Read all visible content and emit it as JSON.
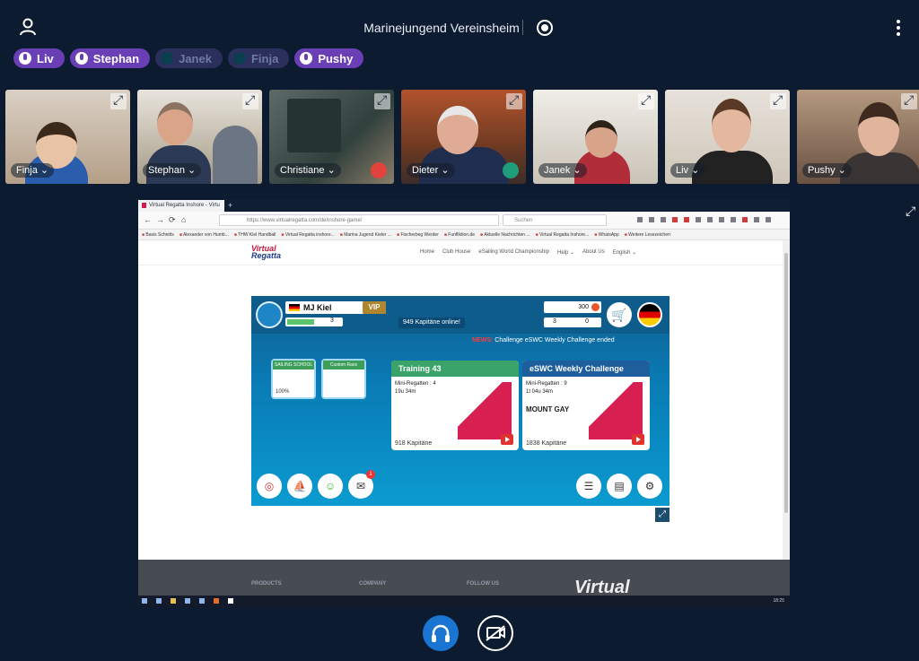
{
  "room": {
    "title": "Marinejungend Vereinsheim"
  },
  "participants_chips": [
    {
      "label": "Liv",
      "state": "active"
    },
    {
      "label": "Stephan",
      "state": "active"
    },
    {
      "label": "Janek",
      "state": "muted"
    },
    {
      "label": "Finja",
      "state": "muted"
    },
    {
      "label": "Pushy",
      "state": "active"
    }
  ],
  "tiles": [
    {
      "name": "Finja"
    },
    {
      "name": "Stephan"
    },
    {
      "name": "Christiane"
    },
    {
      "name": "Dieter"
    },
    {
      "name": "Janek"
    },
    {
      "name": "Liv"
    },
    {
      "name": "Pushy"
    }
  ],
  "browser": {
    "tab_title": "Virtual Regatta Inshore - Virtu",
    "url": "https://www.virtualregatta.com/de/inshore-game/",
    "search_placeholder": "Suchen",
    "bookmarks": [
      "Basis Schnitts",
      "Alexander von Humb...",
      "THW Kiel Handball",
      "Virtual Regatta inshore...",
      "Marina Jugend Kieler ...",
      "Fischerbeg Werder",
      "Funfliktion.de",
      "Aktuelle Nachrichten ...",
      "Virtual Regatta Inshore...",
      "WhatsApp",
      "Weitere Lesezeichen"
    ]
  },
  "site": {
    "logo_line1": "Virtual",
    "logo_line2": "Regatta",
    "nav": [
      "Home",
      "Club House",
      "eSailing World Championship",
      "Help ⌄",
      "About Us",
      "English ⌄"
    ],
    "footer": {
      "products": "PRODUCTS",
      "company": "COMPANY",
      "follow": "FOLLOW US",
      "logo": "Virtual"
    }
  },
  "game": {
    "player_name": "MJ Kiel",
    "vip": "VIP",
    "level": "3",
    "online": "949 Kapitäne online!",
    "coins": "300",
    "gems_a": "3",
    "gems_b": "0",
    "news_label": "NEWS:",
    "news_text": "Challenge eSWC Weekly Challenge ended",
    "sailing_school": "SAILING SCHOOL",
    "sailing_school_progress": "100%",
    "custom_race": "Custom Race",
    "race1": {
      "title": "Training 43",
      "mini": "Mini-Regatten : 4",
      "time": "19u 34m",
      "count": "918 Kapitäne"
    },
    "race2": {
      "title": "eSWC Weekly Challenge",
      "mini": "Mini-Regatten : 9",
      "time": "1t 04u 34m",
      "sponsor": "MOUNT GAY",
      "count": "1838 Kapitäne"
    },
    "mail_badge": "1"
  },
  "taskbar": {
    "clock": "18:25"
  }
}
